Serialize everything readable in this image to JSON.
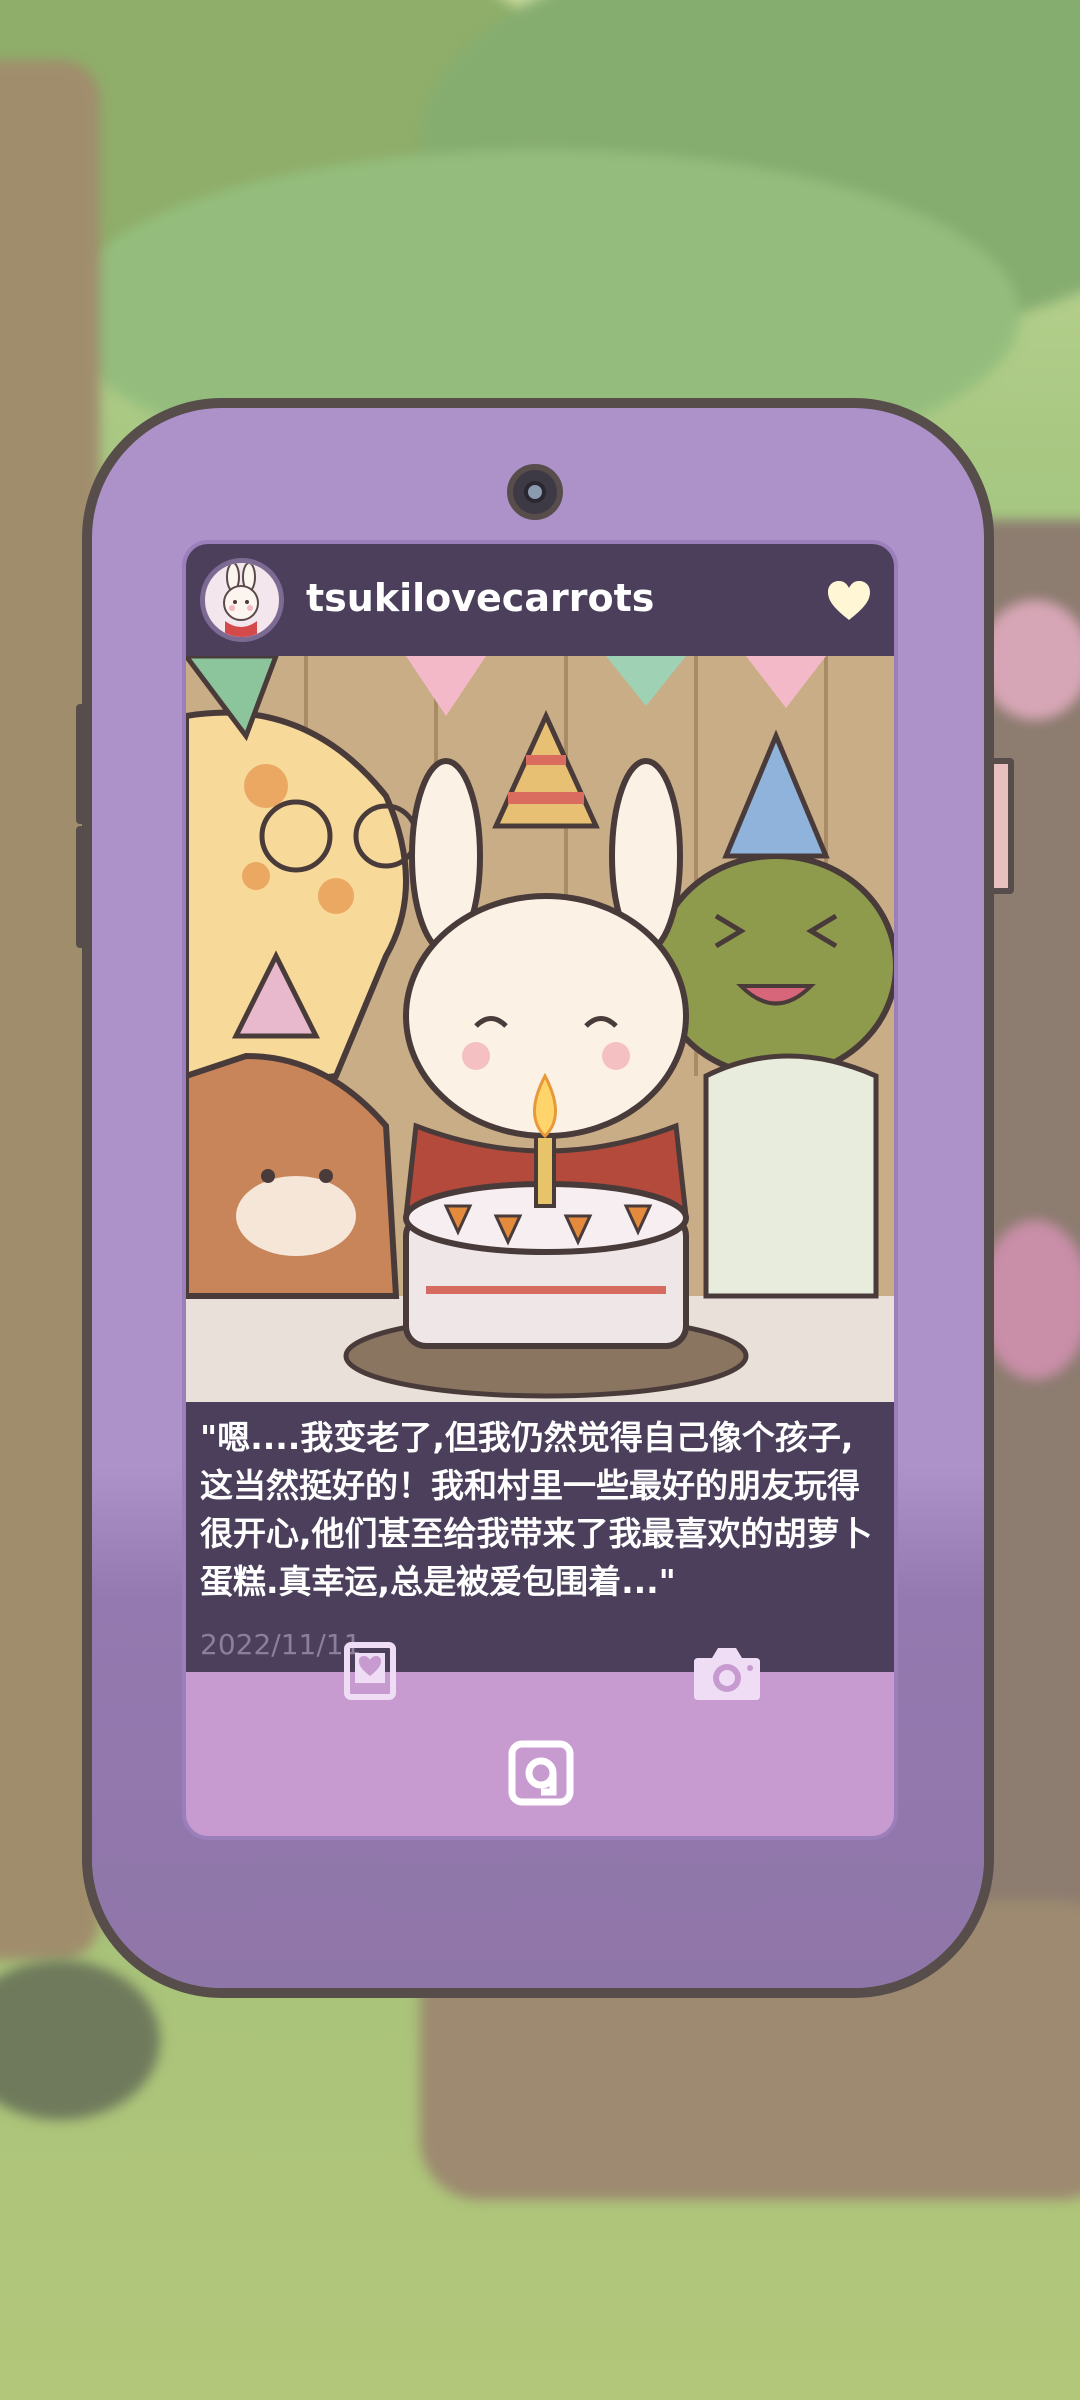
{
  "post": {
    "username": "tsukilovecarrots",
    "caption": "\"嗯....我变老了,但我仍然觉得自己像个孩子,这当然挺好的！我和村里一些最好的朋友玩得很开心,他们甚至给我带来了我最喜欢的胡萝卜蛋糕.真幸运,总是被爱包围着...\"",
    "date": "2022/11/11",
    "photo_subject": "birthday-party-with-cake"
  },
  "icons": {
    "like": "heart-icon",
    "album": "photo-album-icon",
    "camera": "camera-icon",
    "social": "social-app-icon"
  },
  "colors": {
    "phone_body": "#ad91c9",
    "phone_outline": "#574d4b",
    "header_bg": "#4b3f5c",
    "screen_bg": "#c79bcf",
    "heart": "#fff6d6",
    "icon_tint": "#efdcf5"
  }
}
